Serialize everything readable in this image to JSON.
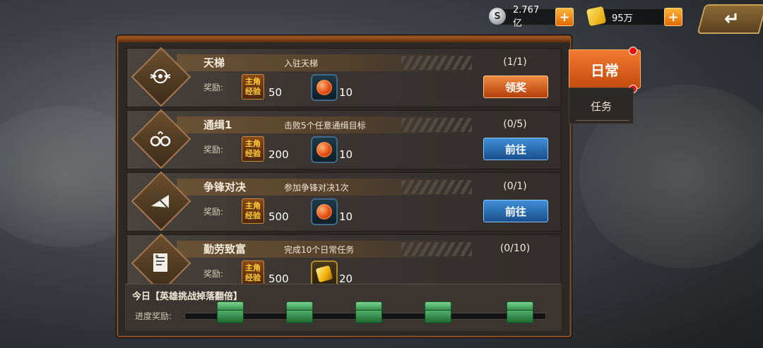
{
  "resources": {
    "silver": {
      "value": "2.767亿",
      "icon": "silver-coin-icon"
    },
    "gold": {
      "value": "95万",
      "icon": "gold-ingot-icon"
    },
    "plus_label": "+",
    "back_label": "↵"
  },
  "tabs": [
    {
      "label": "日常",
      "active": true
    },
    {
      "label": "任务",
      "active": false
    }
  ],
  "reward_label": "奖励:",
  "exp_badge": {
    "line1": "主角",
    "line2": "经验"
  },
  "tasks": [
    {
      "name": "天梯",
      "desc": "入驻天梯",
      "progress": "(1/1)",
      "exp": "50",
      "item_amount": "10",
      "item_icon": "orb-icon",
      "button": "领奖",
      "button_color": "#d2601e",
      "icon": "ladder-emblem-icon"
    },
    {
      "name": "通缉1",
      "desc": "击败5个任意通缉目标",
      "progress": "(0/5)",
      "exp": "200",
      "item_amount": "10",
      "item_icon": "orb-icon",
      "button": "前往",
      "button_color": "#2a6cb8",
      "icon": "handcuffs-icon"
    },
    {
      "name": "争锋对决",
      "desc": "参加争锋对决1次",
      "progress": "(0/1)",
      "exp": "500",
      "item_amount": "10",
      "item_icon": "orb-icon",
      "button": "前往",
      "button_color": "#2a6cb8",
      "icon": "duel-icon"
    },
    {
      "name": "勤劳致富",
      "desc": "完成10个日常任务",
      "progress": "(0/10)",
      "exp": "500",
      "item_amount": "20",
      "item_icon": "gold-gem-icon",
      "button": "",
      "icon": "document-icon"
    }
  ],
  "footer": {
    "today": "今日【英雄挑战掉落翻倍】",
    "progress_label": "进度奖励:",
    "progress_fraction": 0,
    "chest_count": 5
  }
}
